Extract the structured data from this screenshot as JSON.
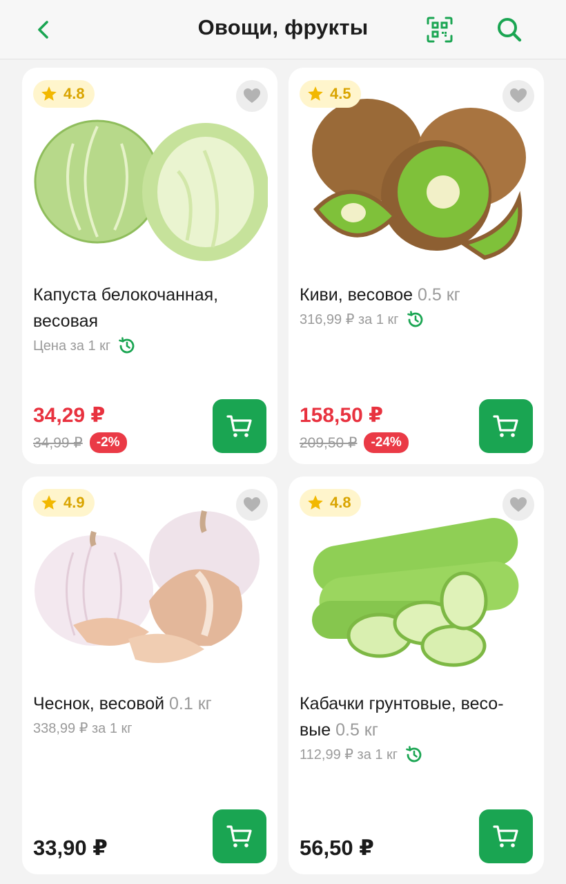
{
  "header": {
    "title": "Овощи, фрукты"
  },
  "products": [
    {
      "rating": "4.8",
      "name": "Капуста белокочанная, весовая",
      "weight": "",
      "unit_price": "Цена за 1 кг",
      "price": "34,29 ₽",
      "old_price": "34,99 ₽",
      "discount": "-2%"
    },
    {
      "rating": "4.5",
      "name": "Киви, весовое",
      "weight": "0.5 кг",
      "unit_price": "316,99 ₽ за 1 кг",
      "price": "158,50 ₽",
      "old_price": "209,50 ₽",
      "discount": "-24%"
    },
    {
      "rating": "4.9",
      "name": "Чеснок, весовой",
      "weight": "0.1 кг",
      "unit_price": "338,99 ₽ за 1 кг",
      "price": "33,90 ₽"
    },
    {
      "rating": "4.8",
      "name": "Кабачки грунтовые, весо-вые",
      "weight": "0.5 кг",
      "unit_price": "112,99 ₽ за 1 кг",
      "price": "56,50 ₽"
    }
  ],
  "icons": {
    "back": "chevron-left-icon",
    "qr": "qr-scan-icon",
    "search": "search-icon",
    "star": "star-icon",
    "favorite": "heart-icon",
    "history": "clock-history-icon",
    "cart": "cart-icon"
  },
  "colors": {
    "accent": "#1aa552",
    "sale": "#e8323f",
    "rating": "#f2b800"
  }
}
